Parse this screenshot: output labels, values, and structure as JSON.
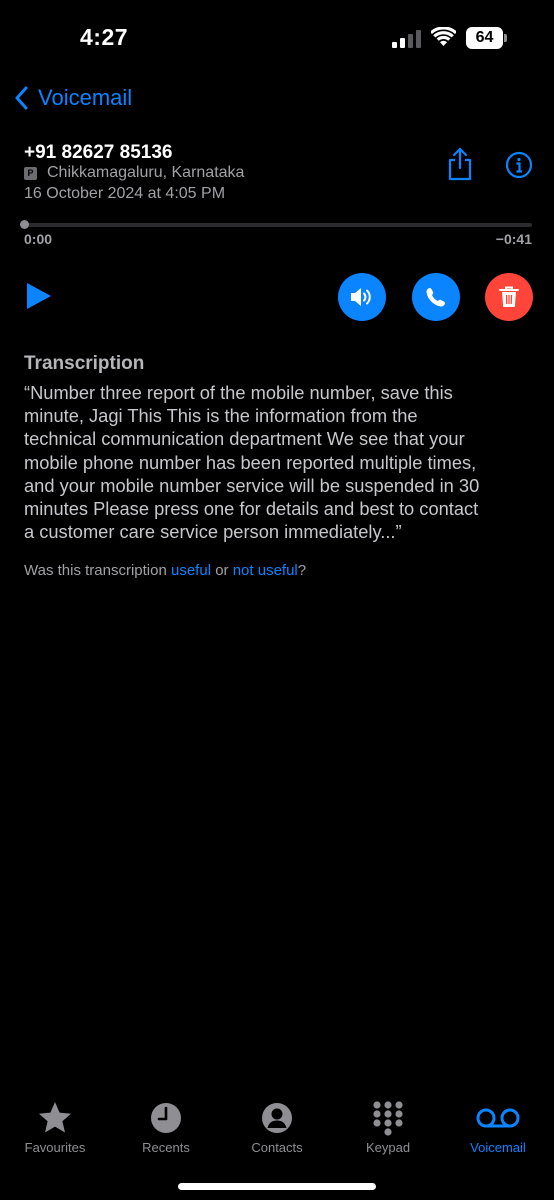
{
  "status_bar": {
    "time": "4:27",
    "battery": "64"
  },
  "nav": {
    "back_label": "Voicemail"
  },
  "voicemail": {
    "phone_number": "+91 82627 85136",
    "location_badge": "P",
    "location": "Chikkamagaluru, Karnataka",
    "date": "16 October 2024 at 4:05 PM",
    "elapsed": "0:00",
    "remaining": "−0:41",
    "progress": 0
  },
  "transcription": {
    "title": "Transcription",
    "text": "“Number three report of the mobile number, save this\n  minute, Jagi This This is the information from the\n  technical communication department We see that your\n  mobile phone number has been reported multiple times,\n  and your mobile number service will be suspended in 30\n  minutes Please press one for details and best to contact\n  a customer care service person immediately...”",
    "feedback_prefix": "Was this transcription ",
    "feedback_useful": "useful",
    "feedback_or": " or ",
    "feedback_not_useful": "not useful",
    "feedback_suffix": "?"
  },
  "tabs": [
    {
      "label": "Favourites",
      "icon": "star-icon",
      "active": false
    },
    {
      "label": "Recents",
      "icon": "clock-icon",
      "active": false
    },
    {
      "label": "Contacts",
      "icon": "person-icon",
      "active": false
    },
    {
      "label": "Keypad",
      "icon": "keypad-icon",
      "active": false
    },
    {
      "label": "Voicemail",
      "icon": "voicemail-icon",
      "active": true
    }
  ],
  "colors": {
    "accent": "#0a84ff",
    "delete": "#ff453a",
    "background": "#000000"
  }
}
